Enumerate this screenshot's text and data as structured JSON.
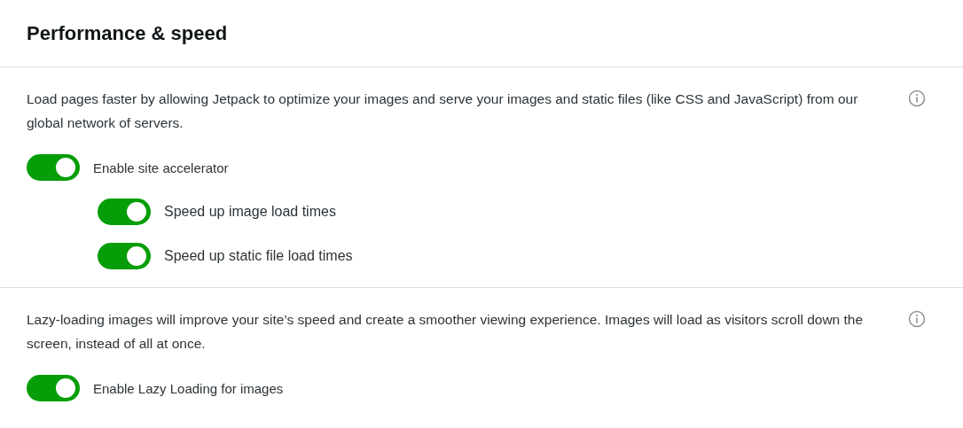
{
  "title": "Performance & speed",
  "sections": [
    {
      "description": "Load pages faster by allowing Jetpack to optimize your images and serve your images and static files (like CSS and JavaScript) from our global network of servers.",
      "toggles": [
        {
          "label": "Enable site accelerator",
          "on": true,
          "children": [
            {
              "label": "Speed up image load times",
              "on": true
            },
            {
              "label": "Speed up static file load times",
              "on": true
            }
          ]
        }
      ]
    },
    {
      "description": "Lazy-loading images will improve your site’s speed and create a smoother viewing experience. Images will load as visitors scroll down the screen, instead of all at once.",
      "toggles": [
        {
          "label": "Enable Lazy Loading for images",
          "on": true
        }
      ]
    }
  ]
}
